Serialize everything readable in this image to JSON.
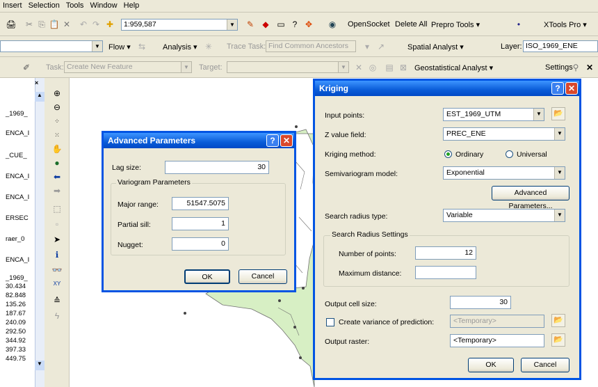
{
  "menu": [
    "Insert",
    "Selection",
    "Tools",
    "Window",
    "Help"
  ],
  "toolbar1": {
    "scale": "1:959,587",
    "opensocket": "OpenSocket",
    "delete_all": "Delete All",
    "prepro_tools": "Prepro Tools",
    "xtools_pro": "XTools Pro"
  },
  "toolbar2": {
    "flow": "Flow",
    "analysis": "Analysis",
    "trace_task_label": "Trace Task:",
    "trace_task_value": "Find Common Ancestors",
    "spatial_analyst": "Spatial Analyst",
    "layer_label": "Layer:",
    "layer_value": "ISO_1969_ENE"
  },
  "toolbar3": {
    "task_label": "Task:",
    "task_value": "Create New Feature",
    "target_label": "Target:",
    "geostatistical_analyst": "Geostatistical Analyst",
    "settings": "Settings"
  },
  "toc_items": [
    "_1969_",
    "ENCA_I",
    "_CUE_",
    "ENCA_I",
    "ENCA_I",
    "ERSEC",
    "raer_0",
    "ENCA_I",
    "_1969_",
    "30.434",
    "82.848",
    "135.26",
    "187.67",
    "240.09",
    "292.50",
    "344.92",
    "397.33",
    "449.75"
  ],
  "advanced": {
    "title": "Advanced Parameters",
    "lag_size_label": "Lag size:",
    "lag_size": "30",
    "group_label": "Variogram Parameters",
    "major_range_label": "Major range:",
    "major_range": "51547.5075",
    "partial_sill_label": "Partial sill:",
    "partial_sill": "1",
    "nugget_label": "Nugget:",
    "nugget": "0",
    "ok": "OK",
    "cancel": "Cancel"
  },
  "kriging": {
    "title": "Kriging",
    "input_points_label": "Input points:",
    "input_points": "EST_1969_UTM",
    "z_value_label": "Z value field:",
    "z_value": "PREC_ENE",
    "method_label": "Kriging method:",
    "ordinary": "Ordinary",
    "universal": "Universal",
    "model_label": "Semivariogram model:",
    "model": "Exponential",
    "advanced_button": "Advanced Parameters...",
    "search_type_label": "Search radius type:",
    "search_type": "Variable",
    "group_label": "Search Radius Settings",
    "num_points_label": "Number of points:",
    "num_points": "12",
    "max_dist_label": "Maximum distance:",
    "max_dist": "",
    "cell_size_label": "Output cell size:",
    "cell_size": "30",
    "variance_label": "Create variance of prediction:",
    "variance_value": "<Temporary>",
    "output_raster_label": "Output raster:",
    "output_raster": "<Temporary>",
    "ok": "OK",
    "cancel": "Cancel"
  },
  "colors": {
    "title_blue": "#0a5cd8",
    "close_red": "#d9482b",
    "map_green": "#d7efc4"
  }
}
